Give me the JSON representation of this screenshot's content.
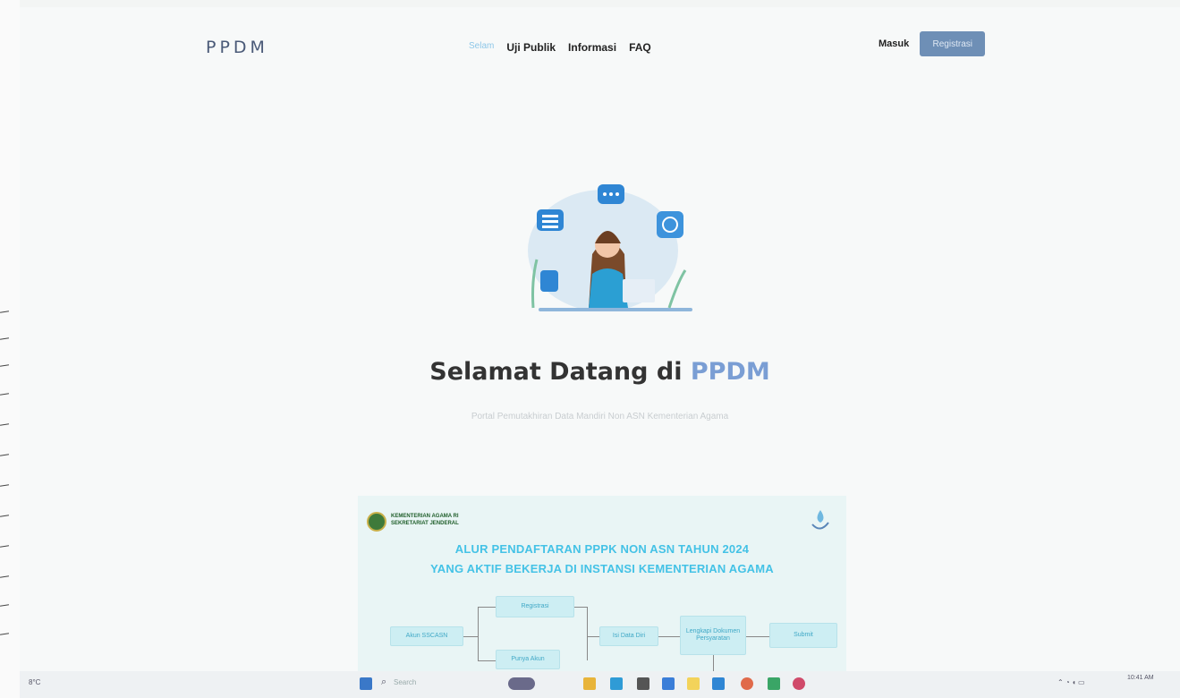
{
  "nav": {
    "logo": "PPDM",
    "links": [
      {
        "label": "Selam",
        "active": true
      },
      {
        "label": "Uji Publik",
        "active": false
      },
      {
        "label": "Informasi",
        "active": false
      },
      {
        "label": "FAQ",
        "active": false
      }
    ],
    "login": "Masuk",
    "register": "Registrasi"
  },
  "hero": {
    "title_main": "Selamat Datang di ",
    "title_accent": "PPDM",
    "subtitle": "Portal Pemutakhiran Data Mandiri Non ASN Kementerian Agama"
  },
  "flyer": {
    "org": "KEMENTERIAN AGAMA RI SEKRETARIAT JENDERAL",
    "title_line1": "ALUR PENDAFTARAN PPPK NON ASN TAHUN 2024",
    "title_line2": "YANG AKTIF BEKERJA DI INSTANSI KEMENTERIAN AGAMA",
    "steps": {
      "start": "Akun SSCASN",
      "registrasi": "Registrasi",
      "punya_akun": "Punya Akun",
      "isi_data": "Isi Data Diri",
      "lengkapi": "Lengkapi Dokumen Persyaratan",
      "submit": "Submit"
    }
  },
  "taskbar": {
    "weather": "8°C",
    "search": "Search",
    "clock": "10:41 AM"
  },
  "colors": {
    "accent": "#7a9ed4",
    "button": "#6e8fb6",
    "flyer_title": "#44c2e6"
  }
}
